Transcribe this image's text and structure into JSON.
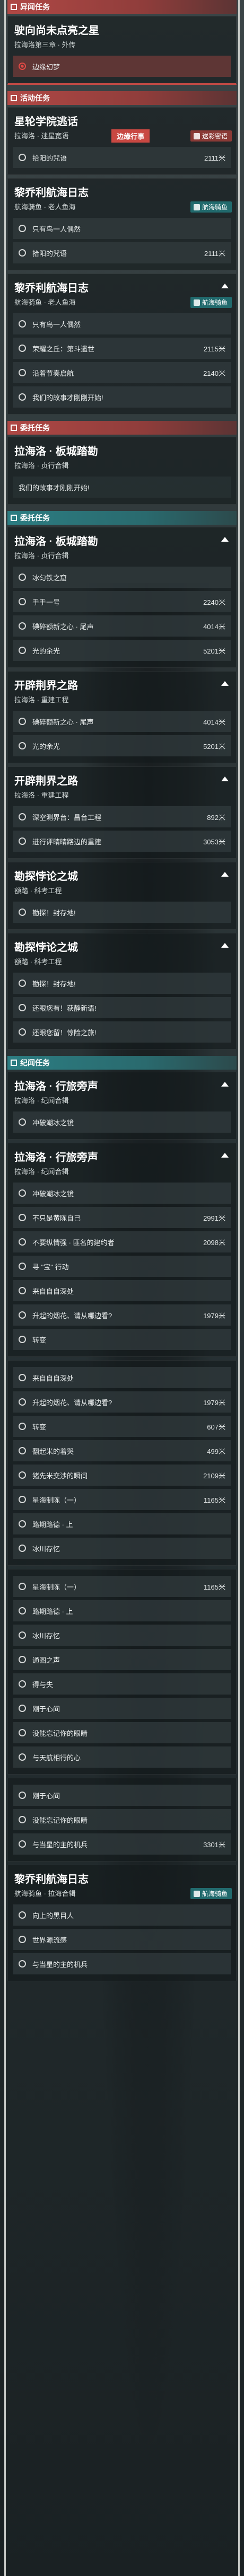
{
  "sections": [
    {
      "kind": "red",
      "label": "异闻任务",
      "cards": [
        {
          "title": "驶向尚未点亮之星",
          "sub": "拉海洛第三章 · 外传",
          "tag": "",
          "toggle": false,
          "hl": true,
          "objectives": [
            {
              "text": "边缘幻梦",
              "dist": "",
              "active": true
            }
          ]
        }
      ]
    },
    {
      "kind": "red",
      "label": "活动任务",
      "cards": [
        {
          "title": "星轮学院逃话",
          "sub": "拉海洛 · 迷星宽语",
          "tag": "边缘行事",
          "badge": "送彩密语",
          "toggle": false,
          "hl": false,
          "objectives": [
            {
              "text": "拾阳的咒语",
              "dist": "2111米"
            }
          ]
        },
        {
          "title": "黎乔利航海日志",
          "sub": "航海骑鱼 · 老人鱼海",
          "tag": "",
          "badge": "航海骑鱼",
          "teal": true,
          "toggle": false,
          "objectives": [
            {
              "text": "只有鸟一人偶然",
              "dist": ""
            },
            {
              "text": "拾阳的咒语",
              "dist": "2111米"
            }
          ]
        },
        {
          "title": "黎乔利航海日志",
          "sub": "航海骑鱼 · 老人鱼海",
          "tag": "",
          "badge": "航海骑鱼",
          "teal": true,
          "toggle": true,
          "objectives": [
            {
              "text": "只有鸟一人偶然",
              "dist": ""
            },
            {
              "text": "荣耀之丘：第斗遗世",
              "dist": "2115米"
            },
            {
              "text": "沿着节奏启航",
              "dist": "2140米"
            },
            {
              "text": "我们的故事才刚刚开始!",
              "dist": ""
            }
          ]
        }
      ]
    },
    {
      "kind": "red",
      "label": "委托任务",
      "cards": [
        {
          "title": "拉海洛 · 板城踏勘",
          "sub": "拉海洛 · 贞行合辑",
          "tag": "",
          "toggle": false,
          "objectives": [
            {
              "text": "我们的故事才刚刚开始!",
              "dist": "",
              "plain": true
            }
          ]
        }
      ]
    },
    {
      "kind": "teal",
      "label": "委托任务",
      "cards": [
        {
          "title": "拉海洛 · 板城踏勘",
          "sub": "拉海洛 · 贞行合辑",
          "tag": "",
          "toggle": true,
          "objectives": [
            {
              "text": "冰匀铁之窟",
              "dist": ""
            },
            {
              "text": "手手一号",
              "dist": "2240米"
            },
            {
              "text": "碘碎额新之心 · 尾声",
              "dist": "4014米"
            },
            {
              "text": "光的余光",
              "dist": "5201米"
            }
          ]
        },
        {
          "title": "开辟荆界之路",
          "sub": "拉海洛 · 重建工程",
          "tag": "",
          "toggle": true,
          "objectives": [
            {
              "text": "碘碎额新之心 · 尾声",
              "dist": "4014米"
            },
            {
              "text": "光的余光",
              "dist": "5201米"
            }
          ]
        },
        {
          "title": "开辟荆界之路",
          "sub": "拉海洛 · 重建工程",
          "tag": "",
          "toggle": true,
          "objectives": [
            {
              "text": "深空测界台：昌台工程",
              "dist": "892米"
            },
            {
              "text": "进行评晴晴路边的重建",
              "dist": "3053米"
            }
          ]
        },
        {
          "title": "勘探悖论之城",
          "sub": "额踏 · 科考工程",
          "tag": "",
          "toggle": true,
          "objectives": [
            {
              "text": "勘探！封存地!",
              "dist": ""
            }
          ]
        },
        {
          "title": "勘探悖论之城",
          "sub": "额踏 · 科考工程",
          "tag": "",
          "toggle": true,
          "objectives": [
            {
              "text": "勘探！封存地!",
              "dist": ""
            },
            {
              "text": "还眼您有！获静新语!",
              "dist": ""
            },
            {
              "text": "还眼您留！惊险之旅!",
              "dist": ""
            }
          ]
        }
      ]
    },
    {
      "kind": "teal",
      "label": "纪闻任务",
      "cards": [
        {
          "title": "拉海洛 · 行旅旁声",
          "sub": "拉海洛 · 纪闻合辑",
          "tag": "",
          "toggle": true,
          "objectives": [
            {
              "text": "冲破潮冰之镜",
              "dist": ""
            }
          ]
        },
        {
          "title": "拉海洛 · 行旅旁声",
          "sub": "拉海洛 · 纪闻合辑",
          "tag": "",
          "toggle": true,
          "objectives": [
            {
              "text": "冲破潮冰之镜",
              "dist": ""
            },
            {
              "text": "不只是黄陈自己",
              "dist": "2991米"
            },
            {
              "text": "不要纵情强 · 匪名的建约者",
              "dist": "2098米"
            },
            {
              "text": "寻 \"宝\" 行动",
              "dist": ""
            },
            {
              "text": "来自自自深处",
              "dist": ""
            },
            {
              "text": "升起的烟花、请从哪边看?",
              "dist": "1979米"
            },
            {
              "text": "转变",
              "dist": ""
            }
          ]
        },
        {
          "title": "",
          "sub": "",
          "tag": "",
          "toggle": false,
          "objectives": [
            {
              "text": "来自自自深处",
              "dist": ""
            },
            {
              "text": "升起的烟花、请从哪边看?",
              "dist": "1979米"
            },
            {
              "text": "转变",
              "dist": "607米"
            },
            {
              "text": "翻起米的着哭",
              "dist": "499米"
            },
            {
              "text": "猪先米交涉的瞬间",
              "dist": "2109米"
            },
            {
              "text": "星海制陈（一）",
              "dist": "1165米"
            },
            {
              "text": "路期路德 · 上",
              "dist": ""
            },
            {
              "text": "冰川存忆",
              "dist": ""
            }
          ]
        },
        {
          "title": "",
          "sub": "",
          "tag": "",
          "toggle": false,
          "objectives": [
            {
              "text": "星海制陈（一）",
              "dist": "1165米"
            },
            {
              "text": "路期路德 · 上",
              "dist": ""
            },
            {
              "text": "冰川存忆",
              "dist": ""
            },
            {
              "text": "通图之声",
              "dist": ""
            },
            {
              "text": "得与失",
              "dist": ""
            },
            {
              "text": "刚于心间",
              "dist": ""
            },
            {
              "text": "没能忘记你的眼睛",
              "dist": ""
            },
            {
              "text": "与天航相行的心",
              "dist": ""
            }
          ]
        },
        {
          "title": "",
          "sub": "",
          "tag": "",
          "toggle": false,
          "objectives": [
            {
              "text": "刚于心间",
              "dist": ""
            },
            {
              "text": "没能忘记你的眼睛",
              "dist": ""
            },
            {
              "text": "与当星的主的机兵",
              "dist": "3301米"
            }
          ]
        },
        {
          "title": "黎乔利航海日志",
          "sub": "航海骑鱼 · 拉海合辑",
          "tag": "",
          "badge": "航海骑鱼",
          "teal": true,
          "toggle": false,
          "objectives": [
            {
              "text": "向上的黑目人",
              "dist": ""
            },
            {
              "text": "世界源流感",
              "dist": ""
            },
            {
              "text": "与当星的主的机兵",
              "dist": ""
            }
          ]
        }
      ]
    }
  ]
}
